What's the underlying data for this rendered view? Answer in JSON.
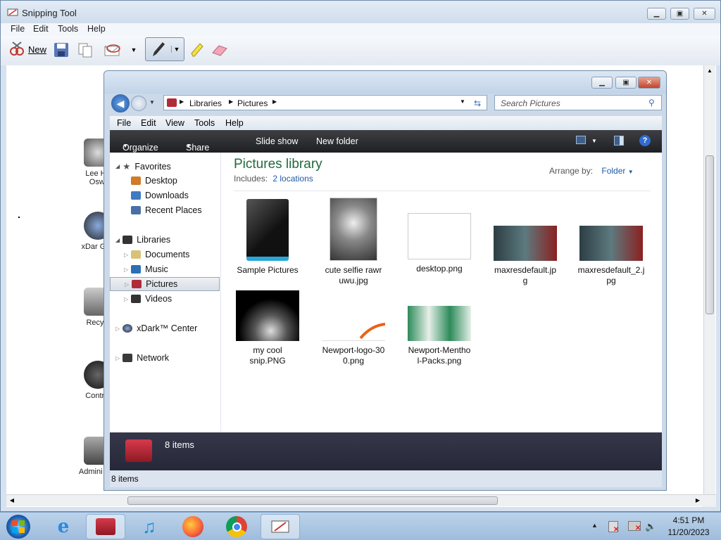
{
  "snip": {
    "title": "Snipping Tool",
    "menu": [
      "File",
      "Edit",
      "Tools",
      "Help"
    ],
    "new_label": "New"
  },
  "desktop_icons": [
    "Lee Ha Oswi",
    "xDar Gen",
    "Recycl",
    "Control",
    "Admini Too"
  ],
  "explorer": {
    "breadcrumb": [
      "Libraries",
      "Pictures"
    ],
    "search_placeholder": "Search Pictures",
    "menu": [
      "File",
      "Edit",
      "View",
      "Tools",
      "Help"
    ],
    "commands": [
      "Organize",
      "Share with",
      "Slide show",
      "New folder"
    ],
    "nav": {
      "favorites": "Favorites",
      "desktop": "Desktop",
      "downloads": "Downloads",
      "recent": "Recent Places",
      "libraries": "Libraries",
      "documents": "Documents",
      "music": "Music",
      "pictures": "Pictures",
      "videos": "Videos",
      "xdark": "xDark™ Center",
      "network": "Network"
    },
    "library_title": "Pictures library",
    "includes_label": "Includes:",
    "includes_link": "2 locations",
    "arrange_label": "Arrange by:",
    "arrange_value": "Folder",
    "files": [
      {
        "line1": "Sample Pictures",
        "line2": ""
      },
      {
        "line1": "cute selfie rawr",
        "line2": "uwu.jpg"
      },
      {
        "line1": "desktop.png",
        "line2": ""
      },
      {
        "line1": "maxresdefault.jp",
        "line2": "g"
      },
      {
        "line1": "maxresdefault_2.j",
        "line2": "pg"
      },
      {
        "line1": "my cool",
        "line2": "snip.PNG"
      },
      {
        "line1": "Newport-logo-30",
        "line2": "0.png"
      },
      {
        "line1": "Newport-Mentho",
        "line2": "l-Packs.png"
      }
    ],
    "details_count": "8 items",
    "status_count": "8 items"
  },
  "tray": {
    "time": "4:51 PM",
    "date": "11/20/2023"
  }
}
